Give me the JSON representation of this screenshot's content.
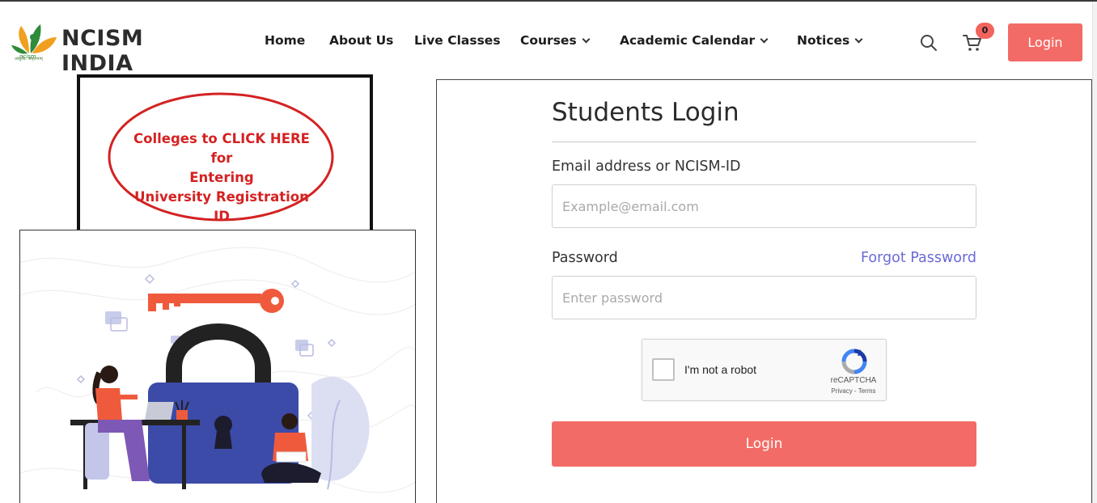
{
  "brand": {
    "name": "NCISM INDIA",
    "logo_mark_text": "ncism",
    "tagline": "आयुर्वेद: अमृतानाम्"
  },
  "nav": {
    "items": [
      {
        "label": "Home",
        "has_dropdown": false
      },
      {
        "label": "About Us",
        "has_dropdown": false
      },
      {
        "label": "Live Classes",
        "has_dropdown": false
      },
      {
        "label": "Courses",
        "has_dropdown": true
      },
      {
        "label": "Academic Calendar",
        "has_dropdown": true
      },
      {
        "label": "Notices",
        "has_dropdown": true
      }
    ]
  },
  "header": {
    "search_icon": "search-icon",
    "cart_icon": "cart-icon",
    "cart_count": "0",
    "login_label": "Login"
  },
  "notice": {
    "line1": "Colleges to CLICK HERE for",
    "line2": "Entering",
    "line3": "University Registration ID"
  },
  "login_form": {
    "title": "Students Login",
    "email_label": "Email address or NCISM-ID",
    "email_placeholder": "Example@email.com",
    "password_label": "Password",
    "forgot_label": "Forgot Password",
    "password_placeholder": "Enter password",
    "submit_label": "Login"
  },
  "captcha": {
    "label": "I'm not a robot",
    "brand": "reCAPTCHA",
    "links": "Privacy - Terms"
  },
  "colors": {
    "accent": "#f36b66",
    "link": "#6a6ad8",
    "notice_red": "#d42222",
    "illustration_navy": "#3c4ba8",
    "illustration_orange": "#f05a3c"
  }
}
